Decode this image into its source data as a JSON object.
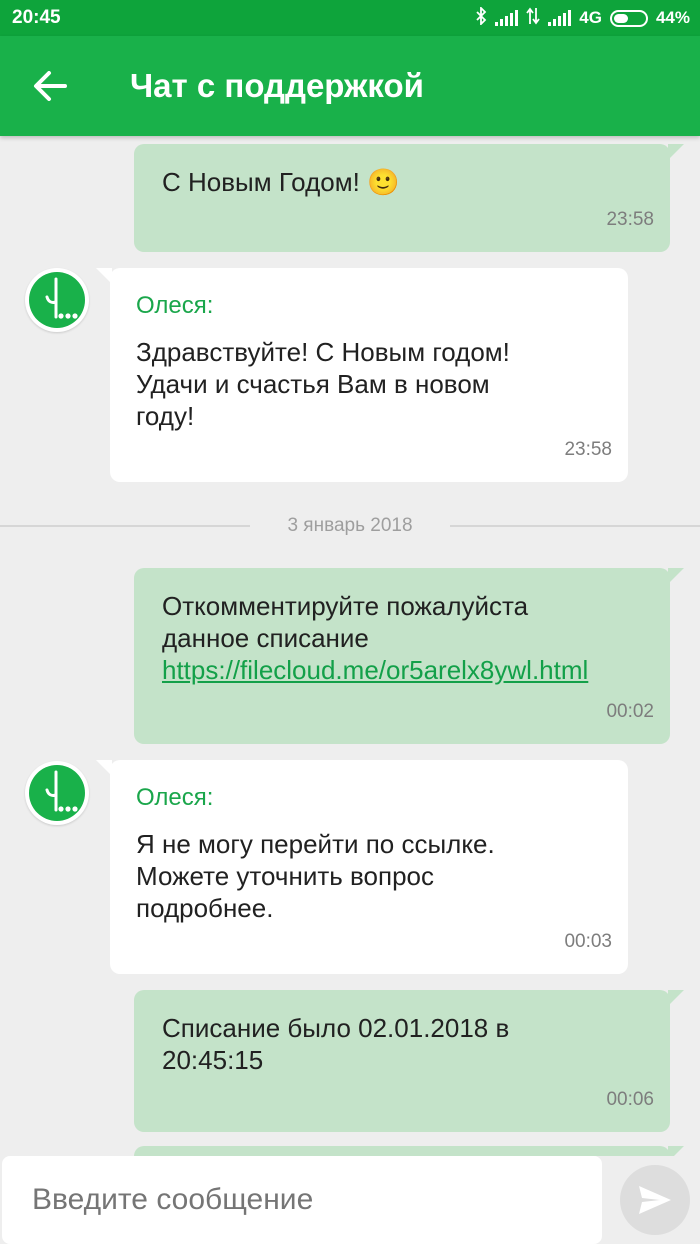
{
  "status_bar": {
    "time": "20:45",
    "network": "4G",
    "battery": "44%"
  },
  "app_bar": {
    "title": "Чат с поддержкой"
  },
  "messages": [
    {
      "type": "out",
      "text": "С Новым Годом! ",
      "emoji": "🙂",
      "time": "23:58"
    },
    {
      "type": "in",
      "sender": "Олеся:",
      "lines": [
        "Здравствуйте! С Новым годом!",
        "Удачи и счастья Вам в новом",
        "году!"
      ],
      "time": "23:58"
    },
    {
      "type": "out",
      "lines": [
        "Откомментируйте пожалуйста",
        "данное списание"
      ],
      "link": "https://filecloud.me/or5arelx8ywl.html",
      "time": "00:02"
    },
    {
      "type": "in",
      "sender": "Олеся:",
      "lines": [
        "Я не могу перейти по ссылке.",
        "Можете уточнить вопрос",
        "подробнее."
      ],
      "time": "00:03"
    },
    {
      "type": "out",
      "lines": [
        "Списание было 02.01.2018 в",
        "20:45:15"
      ],
      "time": "00:06"
    }
  ],
  "date_separator": "3 январь 2018",
  "input": {
    "placeholder": "Введите сообщение"
  },
  "colors": {
    "status_bar": "#0ea43b",
    "app_bar": "#19b14a",
    "outgoing_bubble": "#c4e3c9",
    "incoming_bubble": "#ffffff",
    "sender_name": "#1aa64b",
    "background": "#eeeeee"
  },
  "icons": [
    "back-arrow-icon",
    "bluetooth-icon",
    "signal-icon",
    "battery-icon",
    "operator-logo-icon",
    "send-icon"
  ]
}
